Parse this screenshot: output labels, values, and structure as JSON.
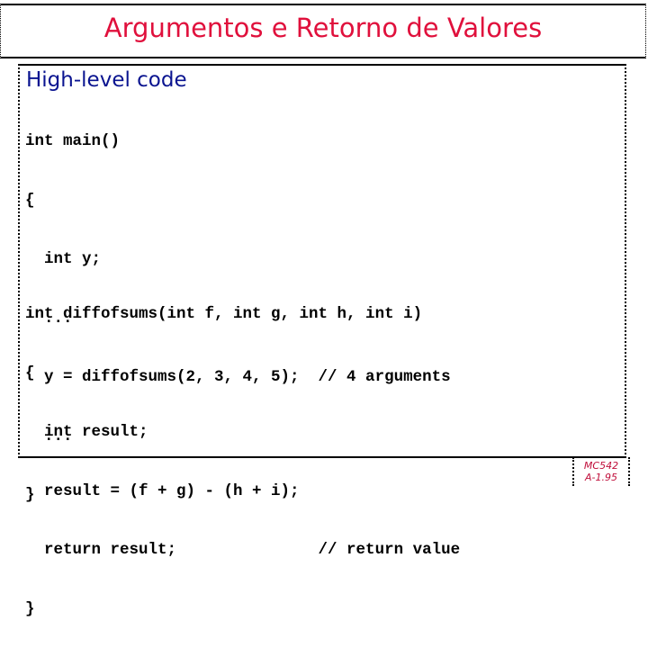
{
  "slide": {
    "title": "Argumentos e Retorno de Valores",
    "heading": "High-level code",
    "code_block_1": [
      "int main()",
      "{",
      "  int y;",
      "  ...",
      "  y = diffofsums(2, 3, 4, 5);  // 4 arguments",
      "  ...",
      "}"
    ],
    "code_block_2": [
      "int diffofsums(int f, int g, int h, int i)",
      "{",
      "  int result;",
      "  result = (f + g) - (h + i);",
      "  return result;               // return value",
      "}"
    ],
    "footer": {
      "course": "MC542",
      "page": "A-1.95"
    },
    "colors": {
      "title": "#e0103c",
      "heading": "#0a1490",
      "footer": "#c0103c"
    }
  }
}
